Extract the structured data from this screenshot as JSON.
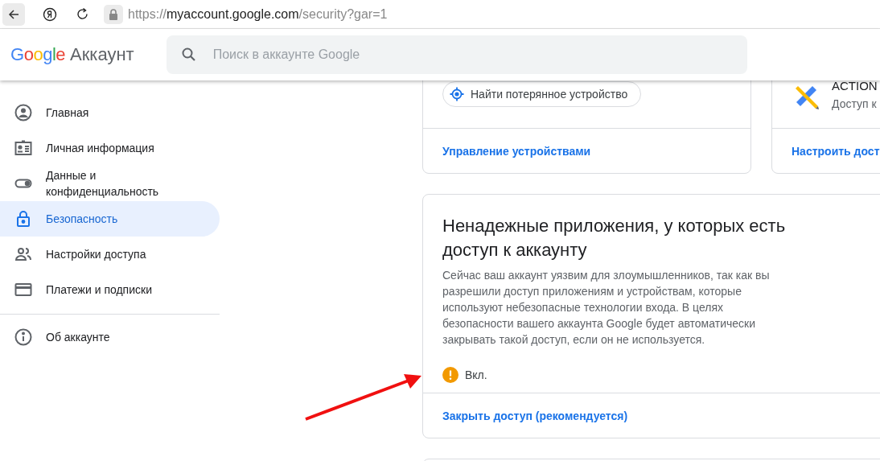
{
  "browser": {
    "url_scheme": "https://",
    "url_host": "myaccount.google.com",
    "url_path": "/security?gar=1"
  },
  "header": {
    "logo": "Google",
    "product": "Аккаунт",
    "search": {
      "placeholder": "Поиск в аккаунте Google"
    }
  },
  "sidebar": {
    "items": [
      {
        "label": "Главная",
        "kind": "home",
        "selected": false
      },
      {
        "label": "Личная информация",
        "kind": "person",
        "selected": false
      },
      {
        "label": "Данные и конфиденциальность",
        "kind": "toggle",
        "selected": false
      },
      {
        "label": "Безопасность",
        "kind": "lock",
        "selected": true
      },
      {
        "label": "Настройки доступа",
        "kind": "people",
        "selected": false
      },
      {
        "label": "Платежи и подписки",
        "kind": "card",
        "selected": false
      }
    ],
    "footer_items": [
      {
        "label": "Об аккаунте",
        "kind": "info",
        "selected": false
      }
    ]
  },
  "devices_card": {
    "chip": "Найти потерянное устройство",
    "link": "Управление устройствами"
  },
  "side_card": {
    "title": "ACTION",
    "subtitle": "Доступ к",
    "link": "Настроить дост"
  },
  "apps_card": {
    "title": "Ненадежные приложения, у которых есть доступ к аккаунту",
    "description": "Сейчас ваш аккаунт уязвим для злоумышленников, так как вы разрешили доступ приложениям и устройствам, которые используют небезопасные технологии входа. В целях безопасности вашего аккаунта Google будет автоматически закрывать такой доступ, если он не используется.",
    "status": {
      "label": "Вкл.",
      "on": true
    },
    "link": "Закрыть доступ (рекомендуется)"
  }
}
